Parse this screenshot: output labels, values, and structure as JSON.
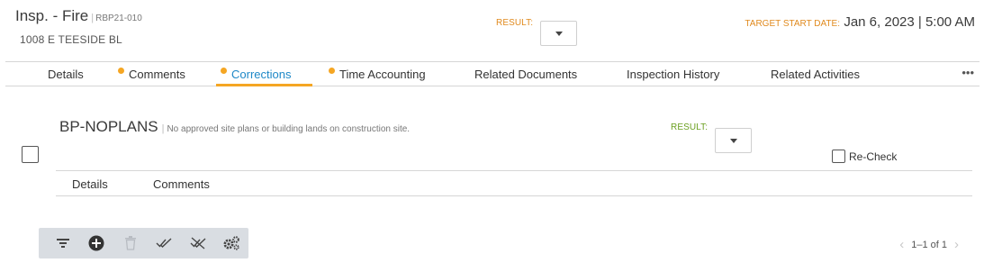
{
  "header": {
    "title": "Insp. - Fire",
    "code": "RBP21-010",
    "address": "1008 E TEESIDE BL",
    "result_label": "RESULT:",
    "target_label": "TARGET START DATE:",
    "target_value": "Jan 6, 2023 | 5:00 AM"
  },
  "tabs": [
    {
      "label": "Details",
      "dot": false,
      "active": false
    },
    {
      "label": "Comments",
      "dot": true,
      "active": false
    },
    {
      "label": "Corrections",
      "dot": true,
      "active": true
    },
    {
      "label": "Time Accounting",
      "dot": true,
      "active": false
    },
    {
      "label": "Related Documents",
      "dot": false,
      "active": false
    },
    {
      "label": "Inspection History",
      "dot": false,
      "active": false
    },
    {
      "label": "Related Activities",
      "dot": false,
      "active": false
    }
  ],
  "more_label": "•••",
  "correction": {
    "code": "BP-NOPLANS",
    "description": "No approved site plans or building lands on construction site.",
    "result_label": "RESULT:",
    "recheck_label": "Re-Check",
    "subtabs": [
      "Details",
      "Comments"
    ]
  },
  "toolbar": {
    "icons": [
      "filter-icon",
      "add-circle-icon",
      "trash-icon",
      "check-all-icon",
      "uncheck-all-icon",
      "settings-gears-icon"
    ]
  },
  "pager": {
    "text": "1–1 of 1",
    "prev": "‹",
    "next": "›"
  },
  "colors": {
    "accent_orange": "#f5a623",
    "label_orange": "#e08a1e",
    "link_blue": "#1e88c7",
    "label_green": "#6a9f1f",
    "toolbar_bg": "#d9dde2"
  }
}
